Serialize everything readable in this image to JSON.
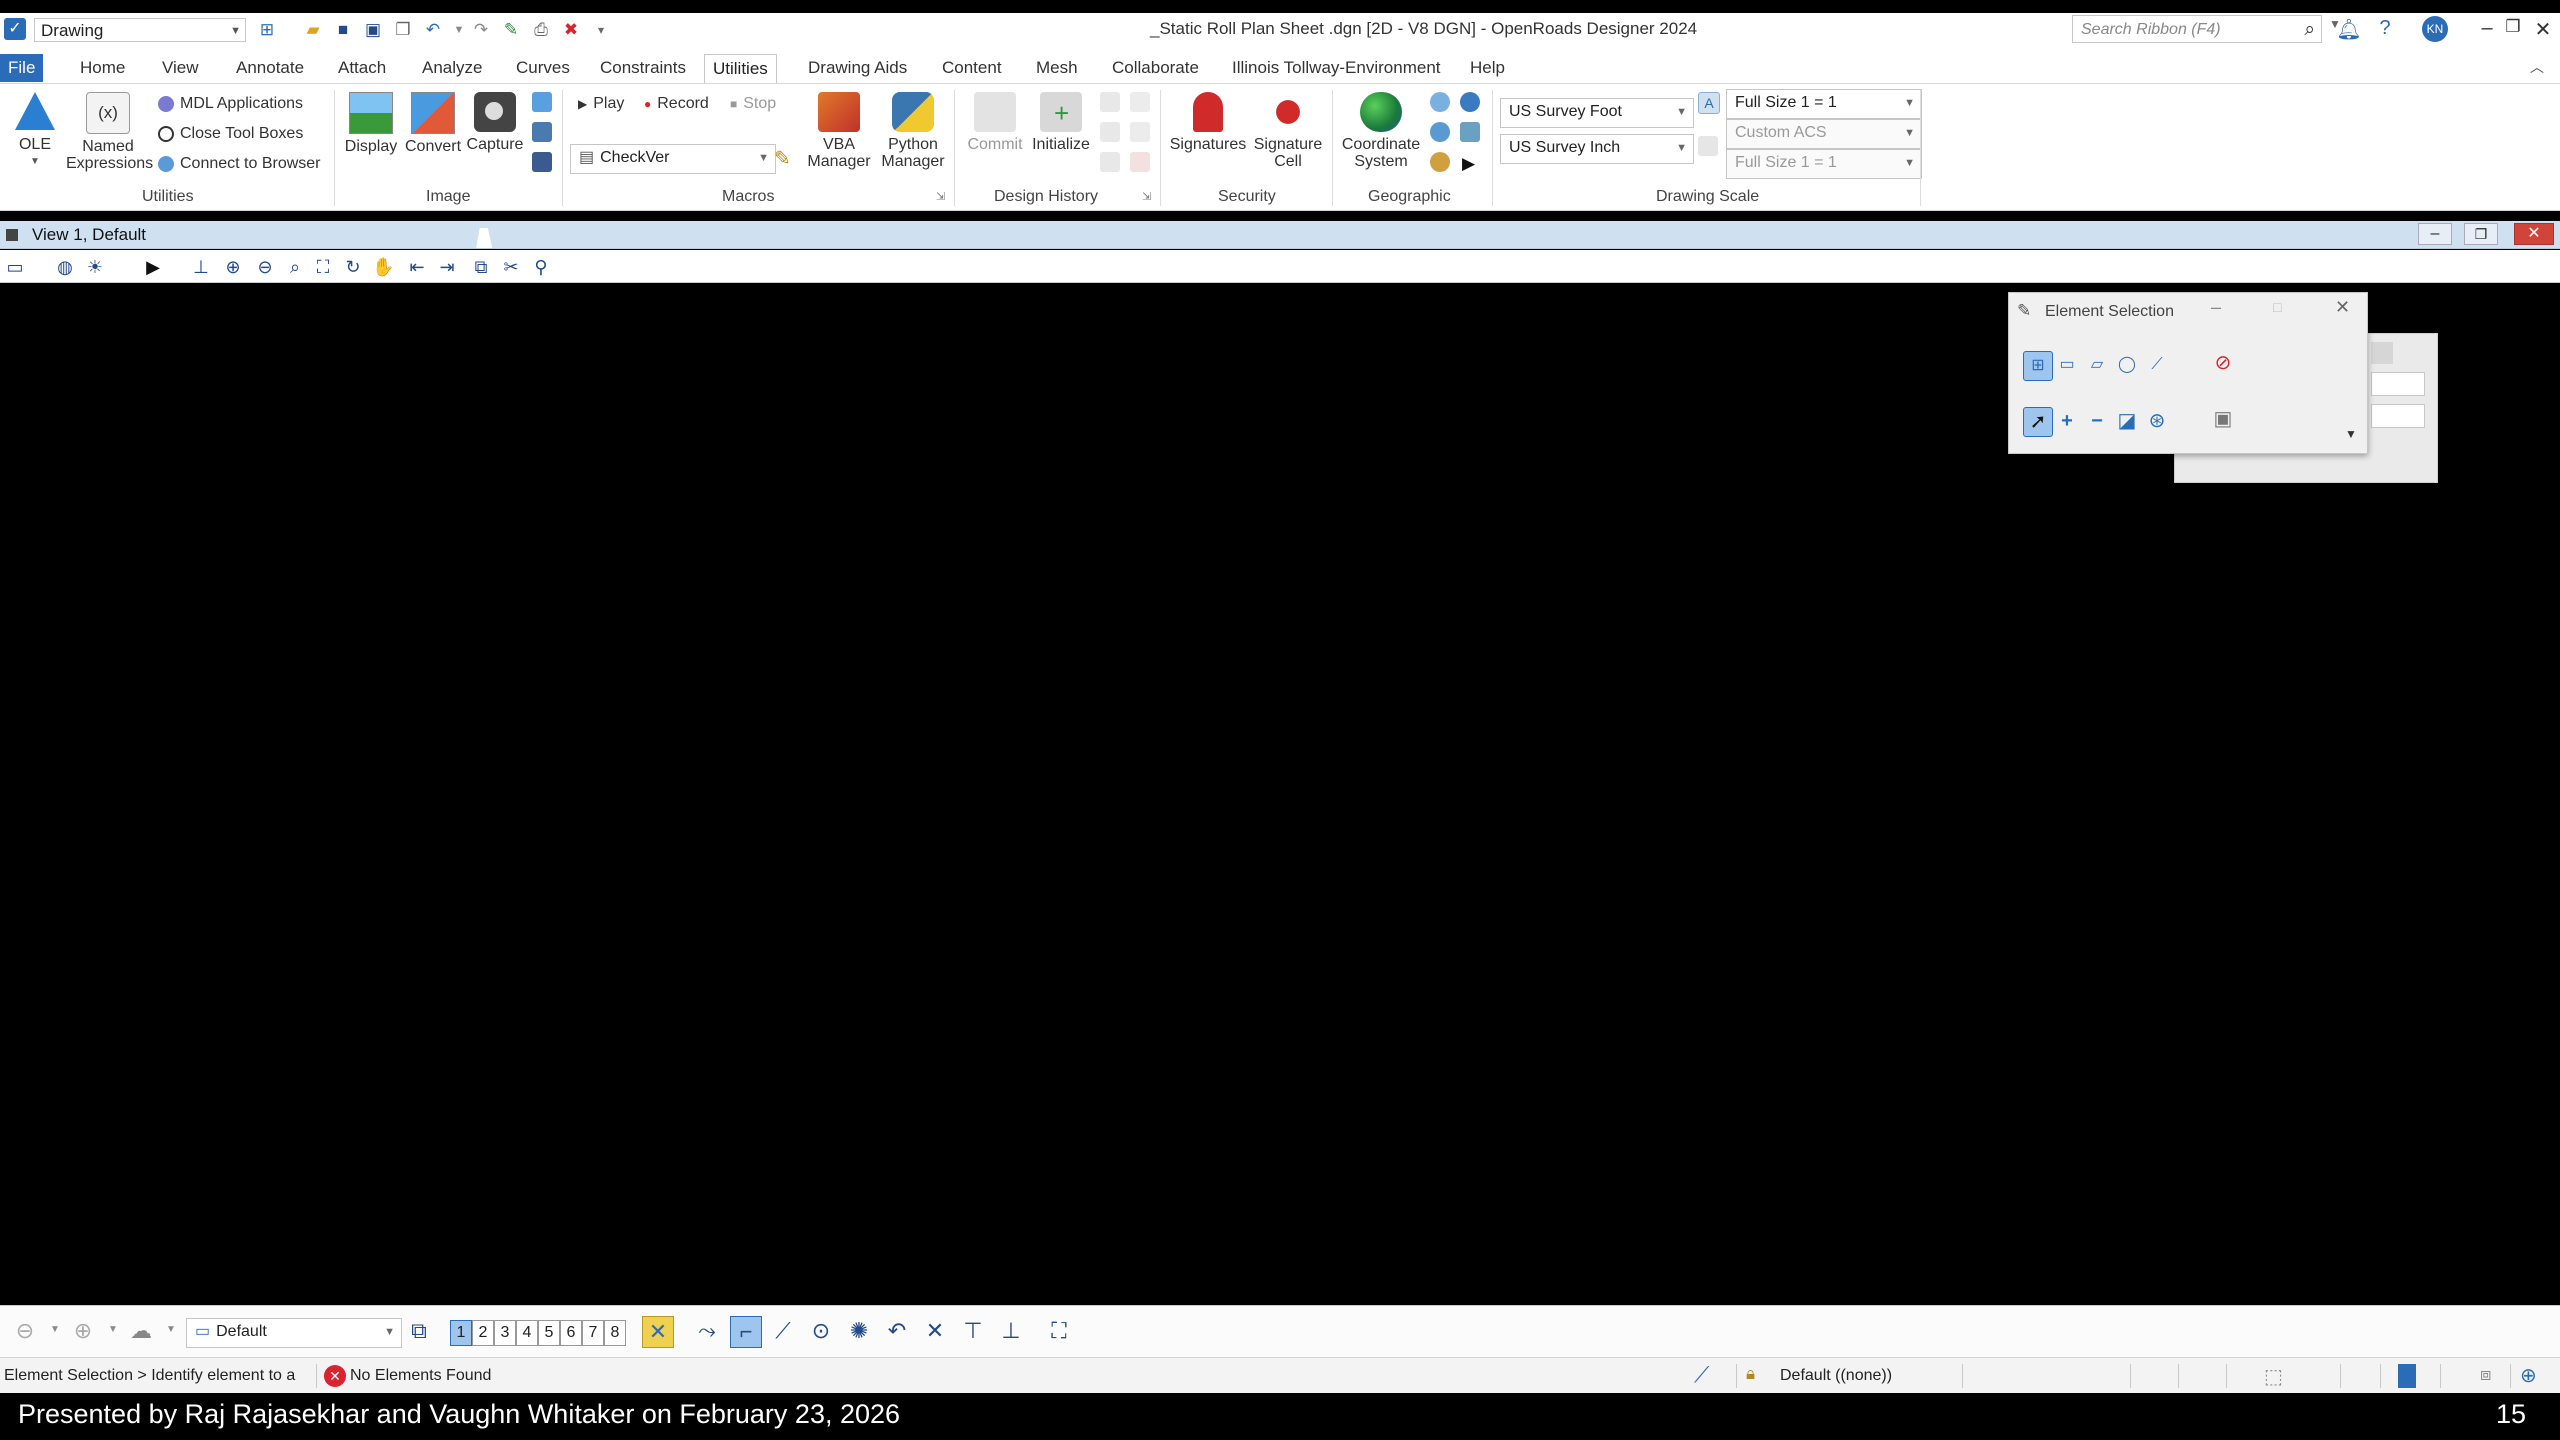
{
  "titlebar": {
    "workspace": "Drawing",
    "document_title": "_Static Roll Plan Sheet .dgn     [2D - V8 DGN] - OpenRoads Designer 2024",
    "search_placeholder": "Search Ribbon (F4)",
    "user_initials": "KN"
  },
  "tabs": [
    "File",
    "Home",
    "View",
    "Annotate",
    "Attach",
    "Analyze",
    "Curves",
    "Constraints",
    "Utilities",
    "Drawing Aids",
    "Content",
    "Mesh",
    "Collaborate",
    "Illinois Tollway-Environment",
    "Help"
  ],
  "active_tab": "Utilities",
  "ribbon": {
    "utilities": {
      "label": "Utilities",
      "ole": "OLE",
      "named_expressions": "Named Expressions",
      "mdl_applications": "MDL Applications",
      "close_tool_boxes": "Close Tool Boxes",
      "connect_to_browser": "Connect to Browser"
    },
    "image": {
      "label": "Image",
      "display": "Display",
      "convert": "Convert",
      "capture": "Capture"
    },
    "macros": {
      "label": "Macros",
      "play": "Play",
      "record": "Record",
      "stop": "Stop",
      "macro_name": "CheckVer",
      "vba_manager": "VBA Manager",
      "python_manager": "Python Manager"
    },
    "design_history": {
      "label": "Design History",
      "commit": "Commit",
      "initialize": "Initialize"
    },
    "security": {
      "label": "Security",
      "signatures": "Signatures",
      "signature_cell": "Signature Cell"
    },
    "geographic": {
      "label": "Geographic",
      "coordinate_system": "Coordinate System"
    },
    "drawing_scale": {
      "label": "Drawing Scale",
      "units_primary": "US Survey Foot",
      "units_secondary": "US Survey Inch",
      "scale_1": "Full Size 1 = 1",
      "scale_2": "Custom ACS",
      "scale_3": "Full Size 1 = 1"
    }
  },
  "view": {
    "title": "View 1, Default"
  },
  "element_selection": {
    "title": "Element Selection"
  },
  "bottom_toolbar": {
    "view_group": "Default",
    "view_numbers": [
      "1",
      "2",
      "3",
      "4",
      "5",
      "6",
      "7",
      "8"
    ],
    "selected_view": "1"
  },
  "statusbar": {
    "prompt": "Element Selection > Identify element to a",
    "message": "No Elements Found",
    "level": "Default ((none))"
  },
  "footer": {
    "presenter_text": "Presented by Raj Rajasekhar and Vaughn Whitaker on February 23, 2026",
    "slide_number": "15"
  },
  "colors": {
    "accent": "#2b6cb8",
    "view_header": "#cfe0f0",
    "canvas": "#000000",
    "error": "#d9232e"
  }
}
